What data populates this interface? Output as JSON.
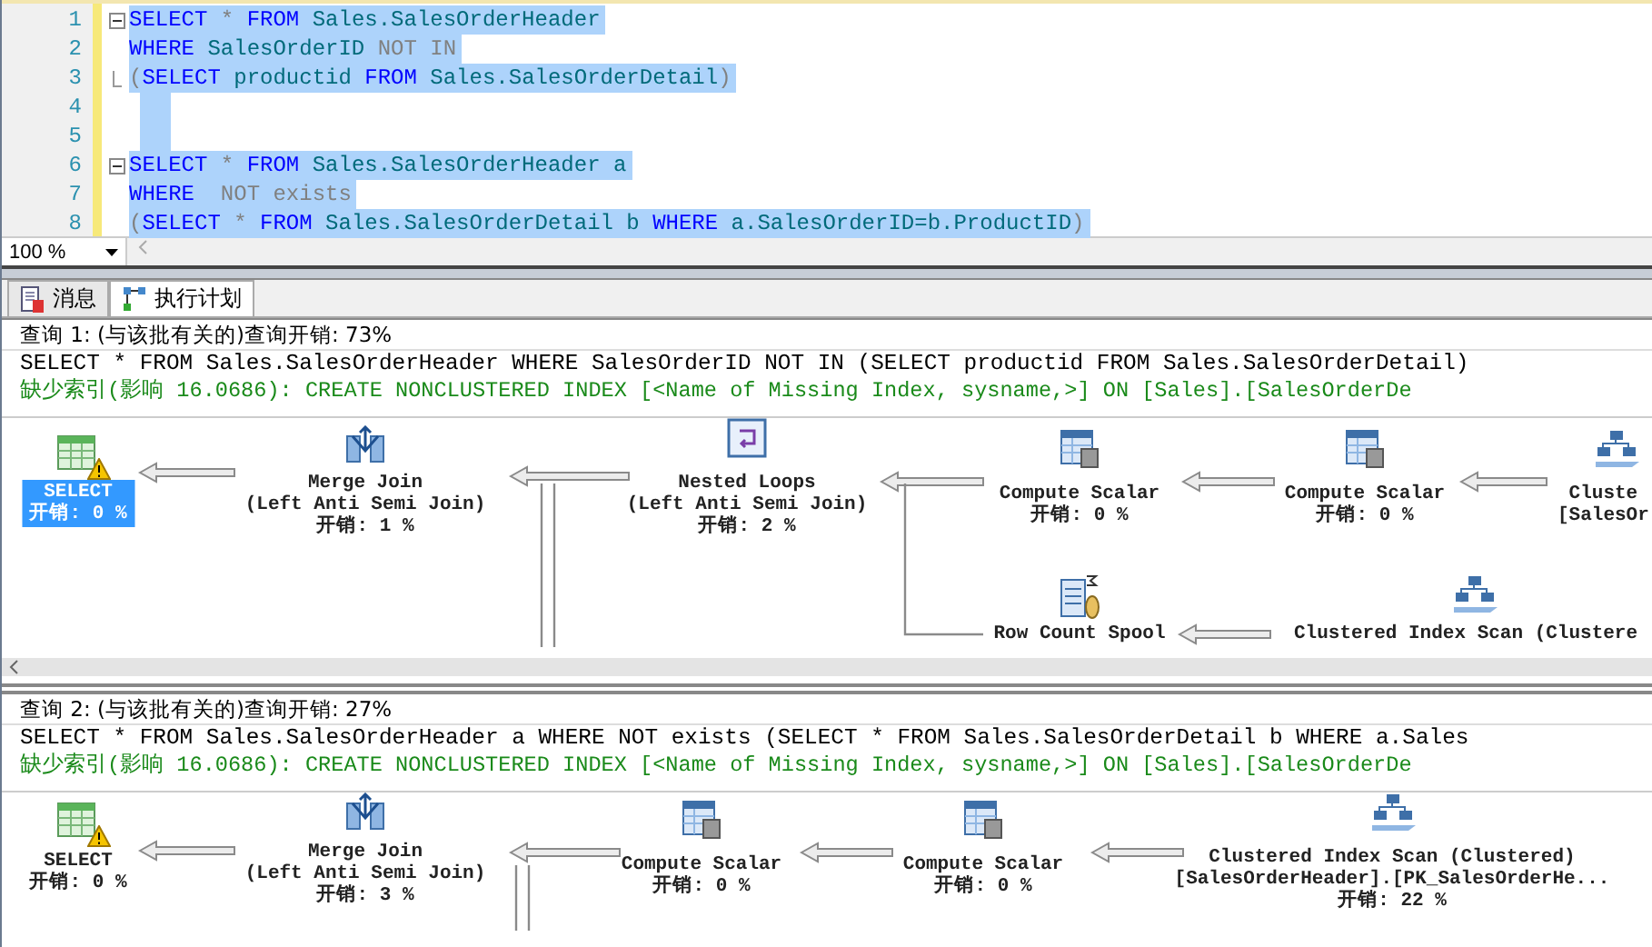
{
  "editor": {
    "lines": [
      {
        "number": "1",
        "fold_start": true,
        "fold_end": false,
        "selected": true,
        "tokens": [
          {
            "text": "SELECT",
            "kind": "kw"
          },
          {
            "text": " * ",
            "kind": "op"
          },
          {
            "text": "FROM",
            "kind": "kw"
          },
          {
            "text": " Sales.SalesOrderHeader",
            "kind": "id"
          }
        ]
      },
      {
        "number": "2",
        "fold_start": false,
        "fold_end": false,
        "selected": true,
        "tokens": [
          {
            "text": "WHERE",
            "kind": "kw"
          },
          {
            "text": " SalesOrderID ",
            "kind": "id"
          },
          {
            "text": "NOT IN",
            "kind": "op"
          }
        ]
      },
      {
        "number": "3",
        "fold_start": false,
        "fold_end": true,
        "selected": true,
        "tokens": [
          {
            "text": "(",
            "kind": "op"
          },
          {
            "text": "SELECT",
            "kind": "kw"
          },
          {
            "text": " productid ",
            "kind": "id"
          },
          {
            "text": "FROM",
            "kind": "kw"
          },
          {
            "text": " Sales.SalesOrderDetail",
            "kind": "id"
          },
          {
            "text": ")",
            "kind": "op"
          }
        ]
      },
      {
        "number": "4",
        "fold_start": false,
        "fold_end": false,
        "selected": true
      },
      {
        "number": "5",
        "fold_start": false,
        "fold_end": false,
        "selected": true
      },
      {
        "number": "6",
        "fold_start": true,
        "fold_end": false,
        "selected": true,
        "tokens": [
          {
            "text": "SELECT",
            "kind": "kw"
          },
          {
            "text": " * ",
            "kind": "op"
          },
          {
            "text": "FROM",
            "kind": "kw"
          },
          {
            "text": " Sales.SalesOrderHeader a",
            "kind": "id"
          }
        ]
      },
      {
        "number": "7",
        "fold_start": false,
        "fold_end": false,
        "selected": true,
        "tokens": [
          {
            "text": "WHERE",
            "kind": "kw"
          },
          {
            "text": "  NOT exists",
            "kind": "op"
          }
        ]
      },
      {
        "number": "8",
        "fold_start": false,
        "fold_end": false,
        "selected": true,
        "tokens": [
          {
            "text": "(",
            "kind": "op"
          },
          {
            "text": "SELECT",
            "kind": "kw"
          },
          {
            "text": " * ",
            "kind": "op"
          },
          {
            "text": "FROM",
            "kind": "kw"
          },
          {
            "text": " Sales.SalesOrderDetail b ",
            "kind": "id"
          },
          {
            "text": "WHERE",
            "kind": "kw"
          },
          {
            "text": " a.SalesOrderID=b.ProductID",
            "kind": "id"
          },
          {
            "text": ")",
            "kind": "op"
          }
        ]
      }
    ],
    "zoom": "100 %"
  },
  "tabs": [
    {
      "label": "消息",
      "kind": "messages",
      "selected": false
    },
    {
      "label": "执行计划",
      "kind": "plan",
      "selected": true
    }
  ],
  "queries": [
    {
      "header": "查询 1: (与该批有关的)查询开销: 73%",
      "sql": "SELECT * FROM Sales.SalesOrderHeader WHERE SalesOrderID NOT IN (SELECT productid FROM Sales.SalesOrderDetail)",
      "missing_index": "缺少索引(影响 16.0686): CREATE NONCLUSTERED INDEX [<Name of Missing Index, sysname,>] ON [Sales].[SalesOrderDe",
      "nodes": [
        {
          "kind": "select",
          "lines": [
            "SELECT",
            "开销: 0 %"
          ],
          "selected": true,
          "warning": true
        },
        {
          "kind": "merge-join",
          "lines": [
            "Merge Join",
            "(Left Anti Semi Join)",
            "开销: 1 %"
          ],
          "selected": false,
          "warning": false
        },
        {
          "kind": "nested-loops",
          "lines": [
            "Nested Loops",
            "(Left Anti Semi Join)",
            "开销: 2 %"
          ],
          "selected": false,
          "warning": false
        },
        {
          "kind": "compute-scalar",
          "lines": [
            "Compute Scalar",
            "开销: 0 %"
          ],
          "selected": false,
          "warning": false
        },
        {
          "kind": "compute-scalar",
          "lines": [
            "Compute Scalar",
            "开销: 0 %"
          ],
          "selected": false,
          "warning": false
        },
        {
          "kind": "index-scan",
          "lines": [
            "Cluste",
            "[SalesOr"
          ],
          "selected": false,
          "warning": false
        },
        {
          "kind": "row-count-spool",
          "lines": [
            "Row Count Spool"
          ],
          "selected": false,
          "warning": false
        },
        {
          "kind": "index-scan",
          "lines": [
            "Clustered Index Scan (Clustere"
          ],
          "selected": false,
          "warning": false
        }
      ]
    },
    {
      "header": "查询 2: (与该批有关的)查询开销: 27%",
      "sql": "SELECT * FROM Sales.SalesOrderHeader a WHERE NOT exists (SELECT * FROM Sales.SalesOrderDetail b WHERE a.Sales",
      "missing_index": "缺少索引(影响 16.0686): CREATE NONCLUSTERED INDEX [<Name of Missing Index, sysname,>] ON [Sales].[SalesOrderDe",
      "nodes": [
        {
          "kind": "select",
          "lines": [
            "SELECT",
            "开销: 0 %"
          ],
          "selected": false,
          "warning": true
        },
        {
          "kind": "merge-join",
          "lines": [
            "Merge Join",
            "(Left Anti Semi Join)",
            "开销: 3 %"
          ],
          "selected": false,
          "warning": false
        },
        {
          "kind": "compute-scalar",
          "lines": [
            "Compute Scalar",
            "开销: 0 %"
          ],
          "selected": false,
          "warning": false
        },
        {
          "kind": "compute-scalar",
          "lines": [
            "Compute Scalar",
            "开销: 0 %"
          ],
          "selected": false,
          "warning": false
        },
        {
          "kind": "index-scan",
          "lines": [
            "Clustered Index Scan (Clustered)",
            "[SalesOrderHeader].[PK_SalesOrderHe...",
            "开销: 22 %"
          ],
          "selected": false,
          "warning": false
        }
      ]
    }
  ]
}
